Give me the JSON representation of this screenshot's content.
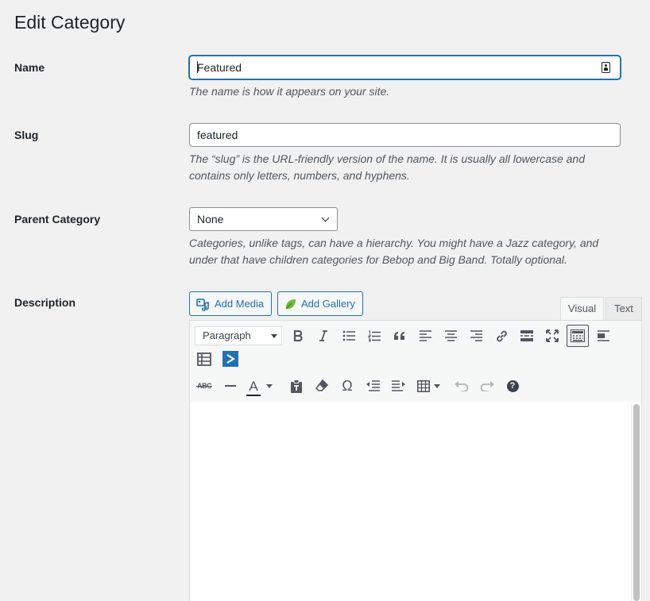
{
  "page": {
    "title": "Edit Category"
  },
  "name_field": {
    "label": "Name",
    "value": "Featured",
    "hint": "The name is how it appears on your site."
  },
  "slug_field": {
    "label": "Slug",
    "value": "featured",
    "hint_line1": "The “slug” is the URL-friendly version of the name. It is usually all lowercase and",
    "hint_line2": "contains only letters, numbers, and hyphens."
  },
  "parent_field": {
    "label": "Parent Category",
    "selected": "None",
    "hint_line1": "Categories, unlike tags, can have a hierarchy. You might have a Jazz category, and",
    "hint_line2": "under that have children categories for Bebop and Big Band. Totally optional."
  },
  "description_field": {
    "label": "Description",
    "add_media_label": "Add Media",
    "add_gallery_label": "Add Gallery",
    "tabs": {
      "visual": "Visual",
      "text": "Text",
      "active": "Visual"
    },
    "format_select": "Paragraph",
    "toolbar_row1_icons": [
      "bold-icon",
      "italic-icon",
      "bulleted-list-icon",
      "numbered-list-icon",
      "blockquote-icon",
      "align-left-icon",
      "align-center-icon",
      "align-right-icon",
      "link-icon",
      "read-more-icon",
      "fullscreen-icon",
      "toolbar-toggle-icon",
      "align-left-alt-icon"
    ],
    "toolbar_row1b_icons": [
      "layout-icon",
      "plugin-arrow-icon"
    ],
    "toolbar_row2_icons": [
      "strikethrough-icon",
      "horizontal-line-icon",
      "text-color-icon",
      "paste-text-icon",
      "clear-formatting-icon",
      "special-character-icon",
      "outdent-icon",
      "indent-icon",
      "table-icon",
      "undo-icon",
      "redo-icon",
      "help-icon"
    ],
    "strikethrough_glyph": "ABC",
    "omega_glyph": "Ω",
    "text_color_glyph": "A",
    "help_glyph": "?",
    "accent_color": "#2271b1",
    "gallery_leaf_color": "#6fba3b"
  }
}
